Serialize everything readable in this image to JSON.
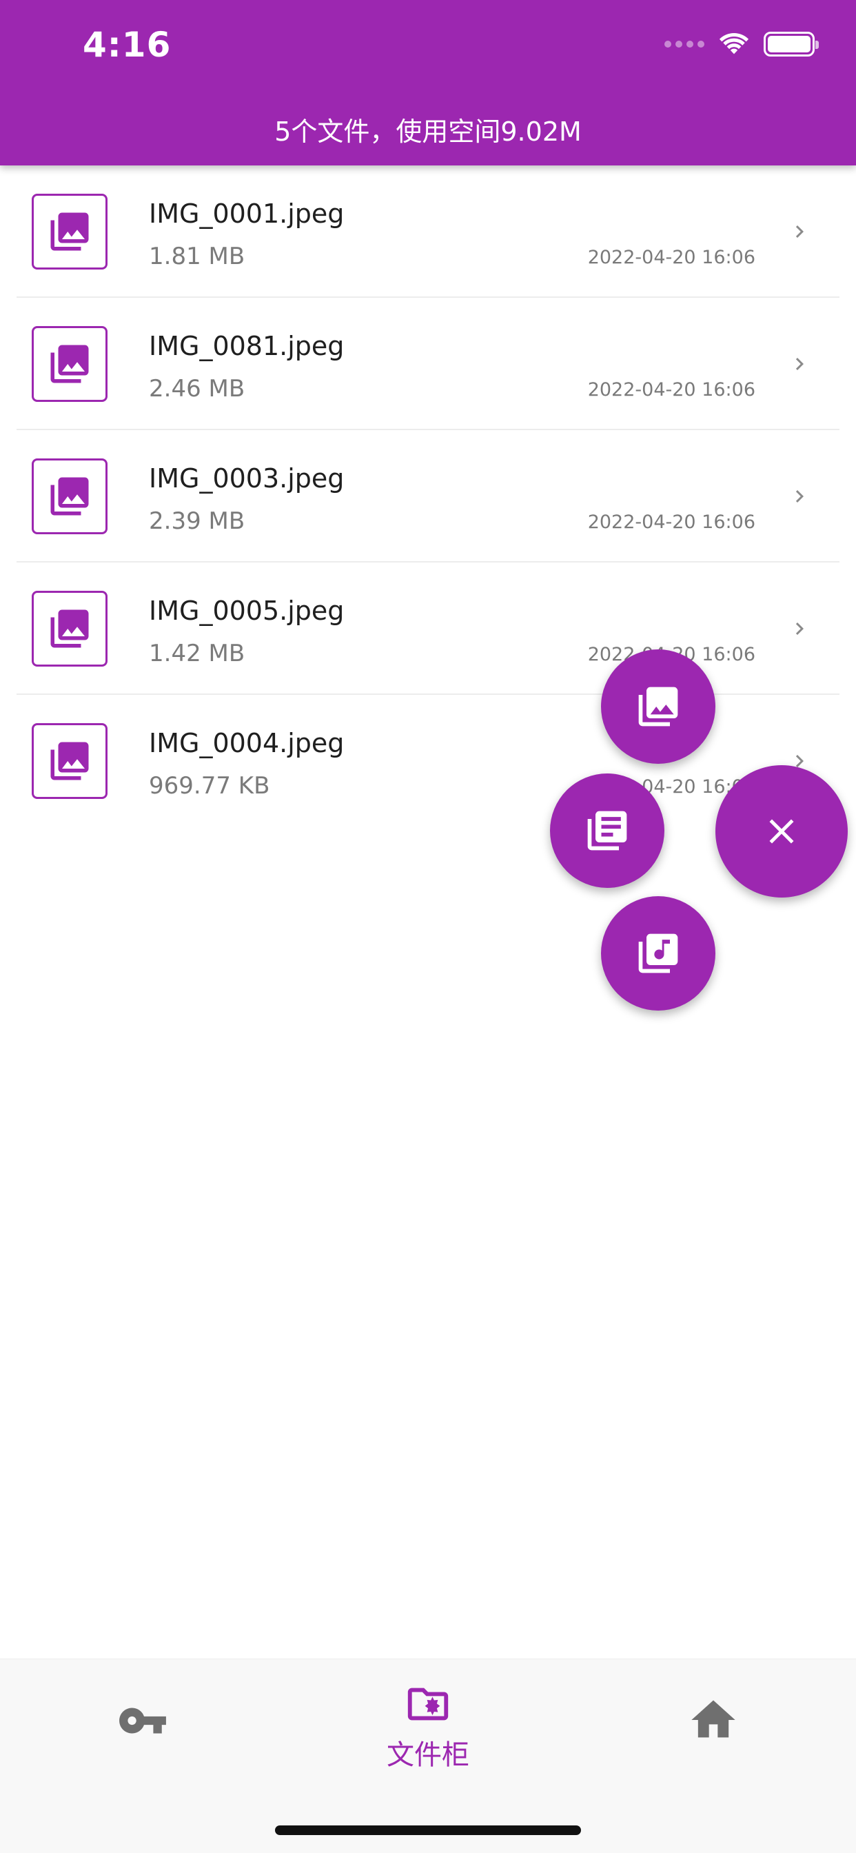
{
  "status_bar": {
    "time": "4:16"
  },
  "header": {
    "title": "5个文件，使用空间9.02M"
  },
  "theme": {
    "accent": "#9c27b0",
    "icon_gray": "#6f6f6f"
  },
  "files": [
    {
      "name": "IMG_0001.jpeg",
      "size": "1.81 MB",
      "date": "2022-04-20 16:06",
      "icon": "image-icon"
    },
    {
      "name": "IMG_0081.jpeg",
      "size": "2.46 MB",
      "date": "2022-04-20 16:06",
      "icon": "image-icon"
    },
    {
      "name": "IMG_0003.jpeg",
      "size": "2.39 MB",
      "date": "2022-04-20 16:06",
      "icon": "image-icon"
    },
    {
      "name": "IMG_0005.jpeg",
      "size": "1.42 MB",
      "date": "2022-04-20 16:06",
      "icon": "image-icon"
    },
    {
      "name": "IMG_0004.jpeg",
      "size": "969.77 KB",
      "date": "2022-04-20 16:06",
      "icon": "image-icon"
    }
  ],
  "fab_menu": {
    "main": "close-icon",
    "actions": [
      "photo-library-icon",
      "document-library-icon",
      "music-library-icon"
    ]
  },
  "bottom_nav": {
    "items": [
      {
        "icon": "key-icon",
        "label": ""
      },
      {
        "icon": "folder-star-icon",
        "label": "文件柜",
        "active": true
      },
      {
        "icon": "home-icon",
        "label": ""
      }
    ]
  }
}
